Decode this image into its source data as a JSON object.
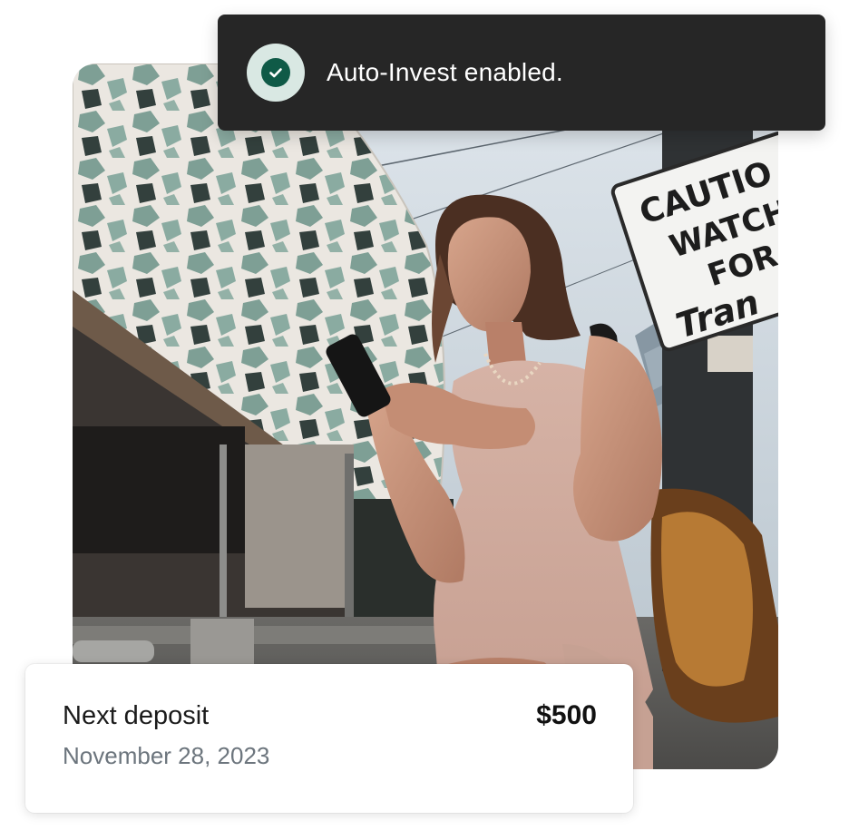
{
  "toast": {
    "icon": "check-circle-icon",
    "message": "Auto-Invest enabled.",
    "background": "#262626",
    "icon_color": "#0f5a47"
  },
  "photo": {
    "sign": {
      "line1": "CAUTIO",
      "line2": "WATCH",
      "line3": "FOR",
      "line4": "Tran"
    }
  },
  "deposit": {
    "label": "Next deposit",
    "amount": "$500",
    "date": "November 28, 2023"
  }
}
